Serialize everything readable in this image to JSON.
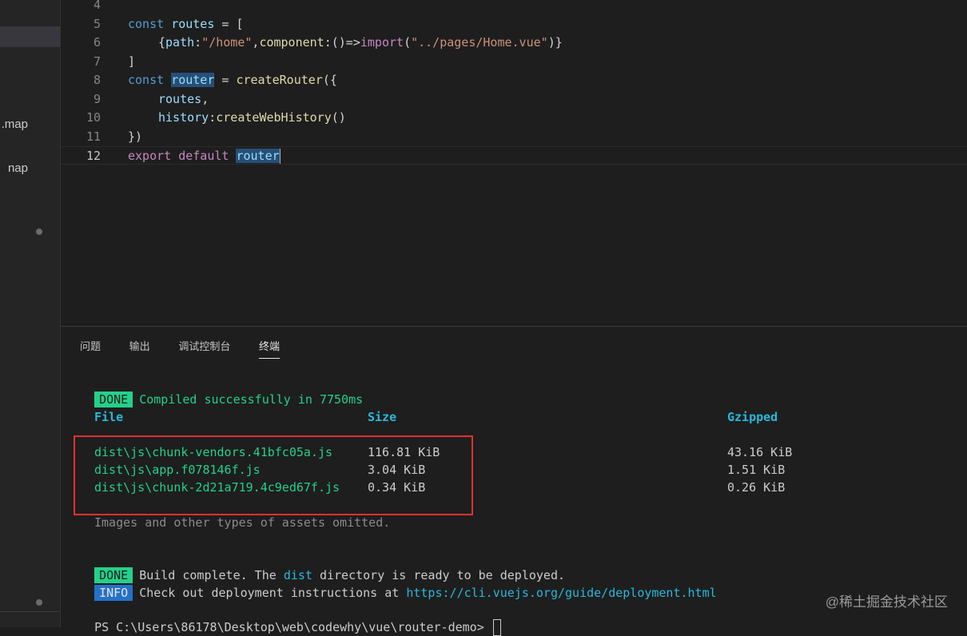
{
  "sidebar": {
    "files": [
      ".map",
      "nap"
    ]
  },
  "editor": {
    "lines": [
      {
        "num": "4",
        "tokens": []
      },
      {
        "num": "5",
        "tokens": [
          {
            "t": "const ",
            "c": "kw2"
          },
          {
            "t": "routes",
            "c": "var"
          },
          {
            "t": " = [",
            "c": "pun"
          }
        ]
      },
      {
        "num": "6",
        "indent": 1,
        "tokens": [
          {
            "t": "{",
            "c": "pun"
          },
          {
            "t": "path",
            "c": "var"
          },
          {
            "t": ":",
            "c": "pun"
          },
          {
            "t": "\"/home\"",
            "c": "str"
          },
          {
            "t": ",",
            "c": "pun"
          },
          {
            "t": "component",
            "c": "fn"
          },
          {
            "t": ":()=>",
            "c": "pun"
          },
          {
            "t": "import",
            "c": "kw"
          },
          {
            "t": "(",
            "c": "pun"
          },
          {
            "t": "\"../pages/Home.vue\"",
            "c": "str"
          },
          {
            "t": ")}",
            "c": "pun"
          }
        ]
      },
      {
        "num": "7",
        "tokens": [
          {
            "t": "]",
            "c": "pun"
          }
        ]
      },
      {
        "num": "8",
        "tokens": [
          {
            "t": "const ",
            "c": "kw2"
          },
          {
            "t": "router",
            "c": "var hl"
          },
          {
            "t": " = ",
            "c": "pun"
          },
          {
            "t": "createRouter",
            "c": "fn"
          },
          {
            "t": "({",
            "c": "pun"
          }
        ]
      },
      {
        "num": "9",
        "indent": 1,
        "tokens": [
          {
            "t": "routes",
            "c": "var"
          },
          {
            "t": ",",
            "c": "pun"
          }
        ]
      },
      {
        "num": "10",
        "indent": 1,
        "tokens": [
          {
            "t": "history",
            "c": "var"
          },
          {
            "t": ":",
            "c": "pun"
          },
          {
            "t": "createWebHistory",
            "c": "fn"
          },
          {
            "t": "()",
            "c": "pun"
          }
        ]
      },
      {
        "num": "11",
        "tokens": [
          {
            "t": "})",
            "c": "pun"
          }
        ]
      },
      {
        "num": "12",
        "current": true,
        "tokens": [
          {
            "t": "export ",
            "c": "kw"
          },
          {
            "t": "default ",
            "c": "kw"
          },
          {
            "t": "router",
            "c": "var hl"
          }
        ]
      }
    ]
  },
  "panel": {
    "tabs": [
      "问题",
      "输出",
      "调试控制台",
      "终端"
    ],
    "active_tab": 3,
    "terminal": {
      "done_label": "DONE",
      "info_label": "INFO",
      "compiled": "Compiled successfully in 7750ms",
      "headers": {
        "file": "File",
        "size": "Size",
        "gzipped": "Gzipped"
      },
      "rows": [
        {
          "file": "dist\\js\\chunk-vendors.41bfc05a.js",
          "size": "116.81 KiB",
          "gzipped": "43.16 KiB"
        },
        {
          "file": "dist\\js\\app.f078146f.js",
          "size": "3.04 KiB",
          "gzipped": "1.51 KiB"
        },
        {
          "file": "dist\\js\\chunk-2d21a719.4c9ed67f.js",
          "size": "0.34 KiB",
          "gzipped": "0.26 KiB"
        }
      ],
      "omitted": "Images and other types of assets omitted.",
      "build_pre": "Build complete. The ",
      "build_dir": "dist",
      "build_post": " directory is ready to be deployed.",
      "deploy_pre": "Check out deployment instructions at ",
      "deploy_url": "https://cli.vuejs.org/guide/deployment.html",
      "prompt": "PS C:\\Users\\86178\\Desktop\\web\\codewhy\\vue\\router-demo> "
    }
  },
  "watermark": "@稀土掘金技术社区",
  "colors": {
    "done": "#23d18b",
    "info": "#2472c8",
    "highlight_box": "#e0312f"
  }
}
